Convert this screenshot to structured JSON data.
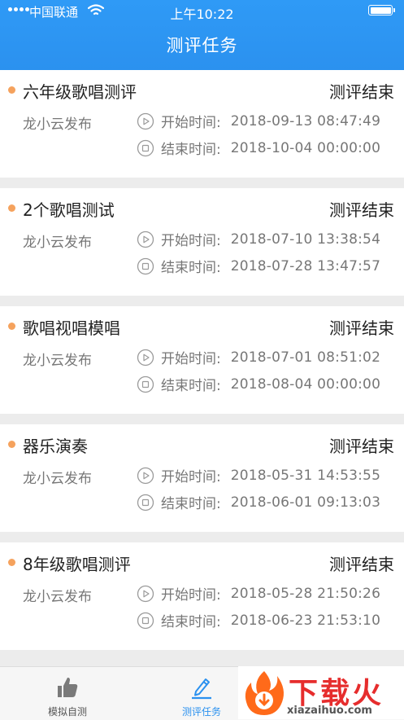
{
  "status_bar": {
    "carrier": "中国联通",
    "time": "上午10:22"
  },
  "nav": {
    "title": "测评任务"
  },
  "tasks": [
    {
      "title": "六年级歌唱测评",
      "status": "测评结束",
      "publisher": "龙小云发布",
      "start_label": "开始时间:",
      "start_time": "2018-09-13 08:47:49",
      "end_label": "结束时间:",
      "end_time": "2018-10-04 00:00:00"
    },
    {
      "title": "2个歌唱测试",
      "status": "测评结束",
      "publisher": "龙小云发布",
      "start_label": "开始时间:",
      "start_time": "2018-07-10 13:38:54",
      "end_label": "结束时间:",
      "end_time": "2018-07-28 13:47:57"
    },
    {
      "title": "歌唱视唱模唱",
      "status": "测评结束",
      "publisher": "龙小云发布",
      "start_label": "开始时间:",
      "start_time": "2018-07-01 08:51:02",
      "end_label": "结束时间:",
      "end_time": "2018-08-04 00:00:00"
    },
    {
      "title": "器乐演奏",
      "status": "测评结束",
      "publisher": "龙小云发布",
      "start_label": "开始时间:",
      "start_time": "2018-05-31 14:53:55",
      "end_label": "结束时间:",
      "end_time": "2018-06-01 09:13:03"
    },
    {
      "title": "8年级歌唱测评",
      "status": "测评结束",
      "publisher": "龙小云发布",
      "start_label": "开始时间:",
      "start_time": "2018-05-28 21:50:26",
      "end_label": "结束时间:",
      "end_time": "2018-06-23 21:53:10"
    }
  ],
  "tabbar": {
    "practice": {
      "label": "模拟自测",
      "icon": "thumbs-up-icon"
    },
    "tasks": {
      "label": "测评任务",
      "icon": "pencil-icon",
      "active": true
    }
  },
  "watermark": {
    "text": "下载火",
    "url": "xiazaihuo.com"
  },
  "colors": {
    "header": "#2b91ef",
    "accent_dot": "#f5a25d",
    "active_tab": "#2b91ef",
    "watermark": "#e62d2d"
  }
}
